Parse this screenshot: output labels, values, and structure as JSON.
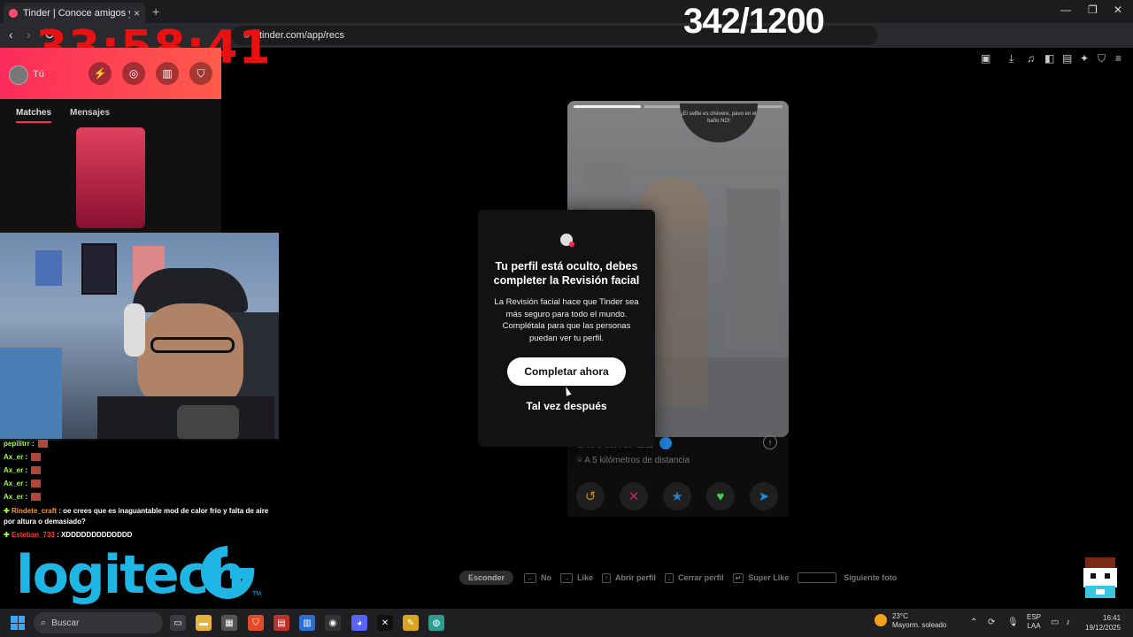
{
  "browser": {
    "tab_title": "Tinder | Conoce amigos y gente",
    "tab_close": "×",
    "new_tab": "+",
    "url": "tinder.com/app/recs",
    "win_min": "—",
    "win_max": "❐",
    "win_close": "✕"
  },
  "overlay": {
    "timer": "33:58:41",
    "counter": "342/1200"
  },
  "sidebar": {
    "you_label": "Tú",
    "tabs": [
      "Matches",
      "Mensajes"
    ]
  },
  "chat": [
    {
      "user": "pepilitrr",
      "msg": ""
    },
    {
      "user": "Ax_er",
      "msg": ""
    },
    {
      "user": "Ax_er",
      "msg": ""
    },
    {
      "user": "Ax_er",
      "msg": ""
    },
    {
      "user": "Ax_er",
      "msg": ""
    },
    {
      "user": "Rindete_craft",
      "msg": "oe crees que es inaguantable mod de calor frío y falta de aire por altura o demasiado?"
    },
    {
      "user": "Esteban_733",
      "msg": "XDDDDDDDDDDDDD"
    }
  ],
  "brand": {
    "logitech": "logitech",
    "tm": "TM"
  },
  "card": {
    "name": "Silvana 21",
    "distance": "A 5 kilómetros de distancia",
    "selfie_badge": "¡El selfie es chévere, pavo en el baño NO!"
  },
  "modal": {
    "title": "Tu perfil está oculto, debes completer la Revisión facial",
    "body": "La Revisión facial hace que Tinder sea más seguro para todo el mundo. Complétala para que las personas puedan ver tu perfil.",
    "primary_button": "Completar ahora",
    "secondary_button": "Tal vez después"
  },
  "shortcuts": {
    "hide": "Esconder",
    "items": [
      {
        "key": "←",
        "label": "No"
      },
      {
        "key": "→",
        "label": "Like"
      },
      {
        "key": "↑",
        "label": "Abrir perfil"
      },
      {
        "key": "↓",
        "label": "Cerrar perfil"
      },
      {
        "key": "↵",
        "label": "Super Like"
      },
      {
        "key": "",
        "label": "Siguiente foto"
      }
    ]
  },
  "taskbar": {
    "search": "Buscar",
    "weather_temp": "23°C",
    "weather_desc": "Mayorm. soleado",
    "lang_1": "ESP",
    "lang_2": "LAA",
    "time": "16:41",
    "date": "19/12/2025"
  },
  "colors": {
    "tinder_gradient": "#fd2b5b",
    "timer_red": "#e81010",
    "logitech_blue": "#1fb6e6",
    "super_like_blue": "#3aa7ff",
    "like_green": "#3fcf55"
  }
}
